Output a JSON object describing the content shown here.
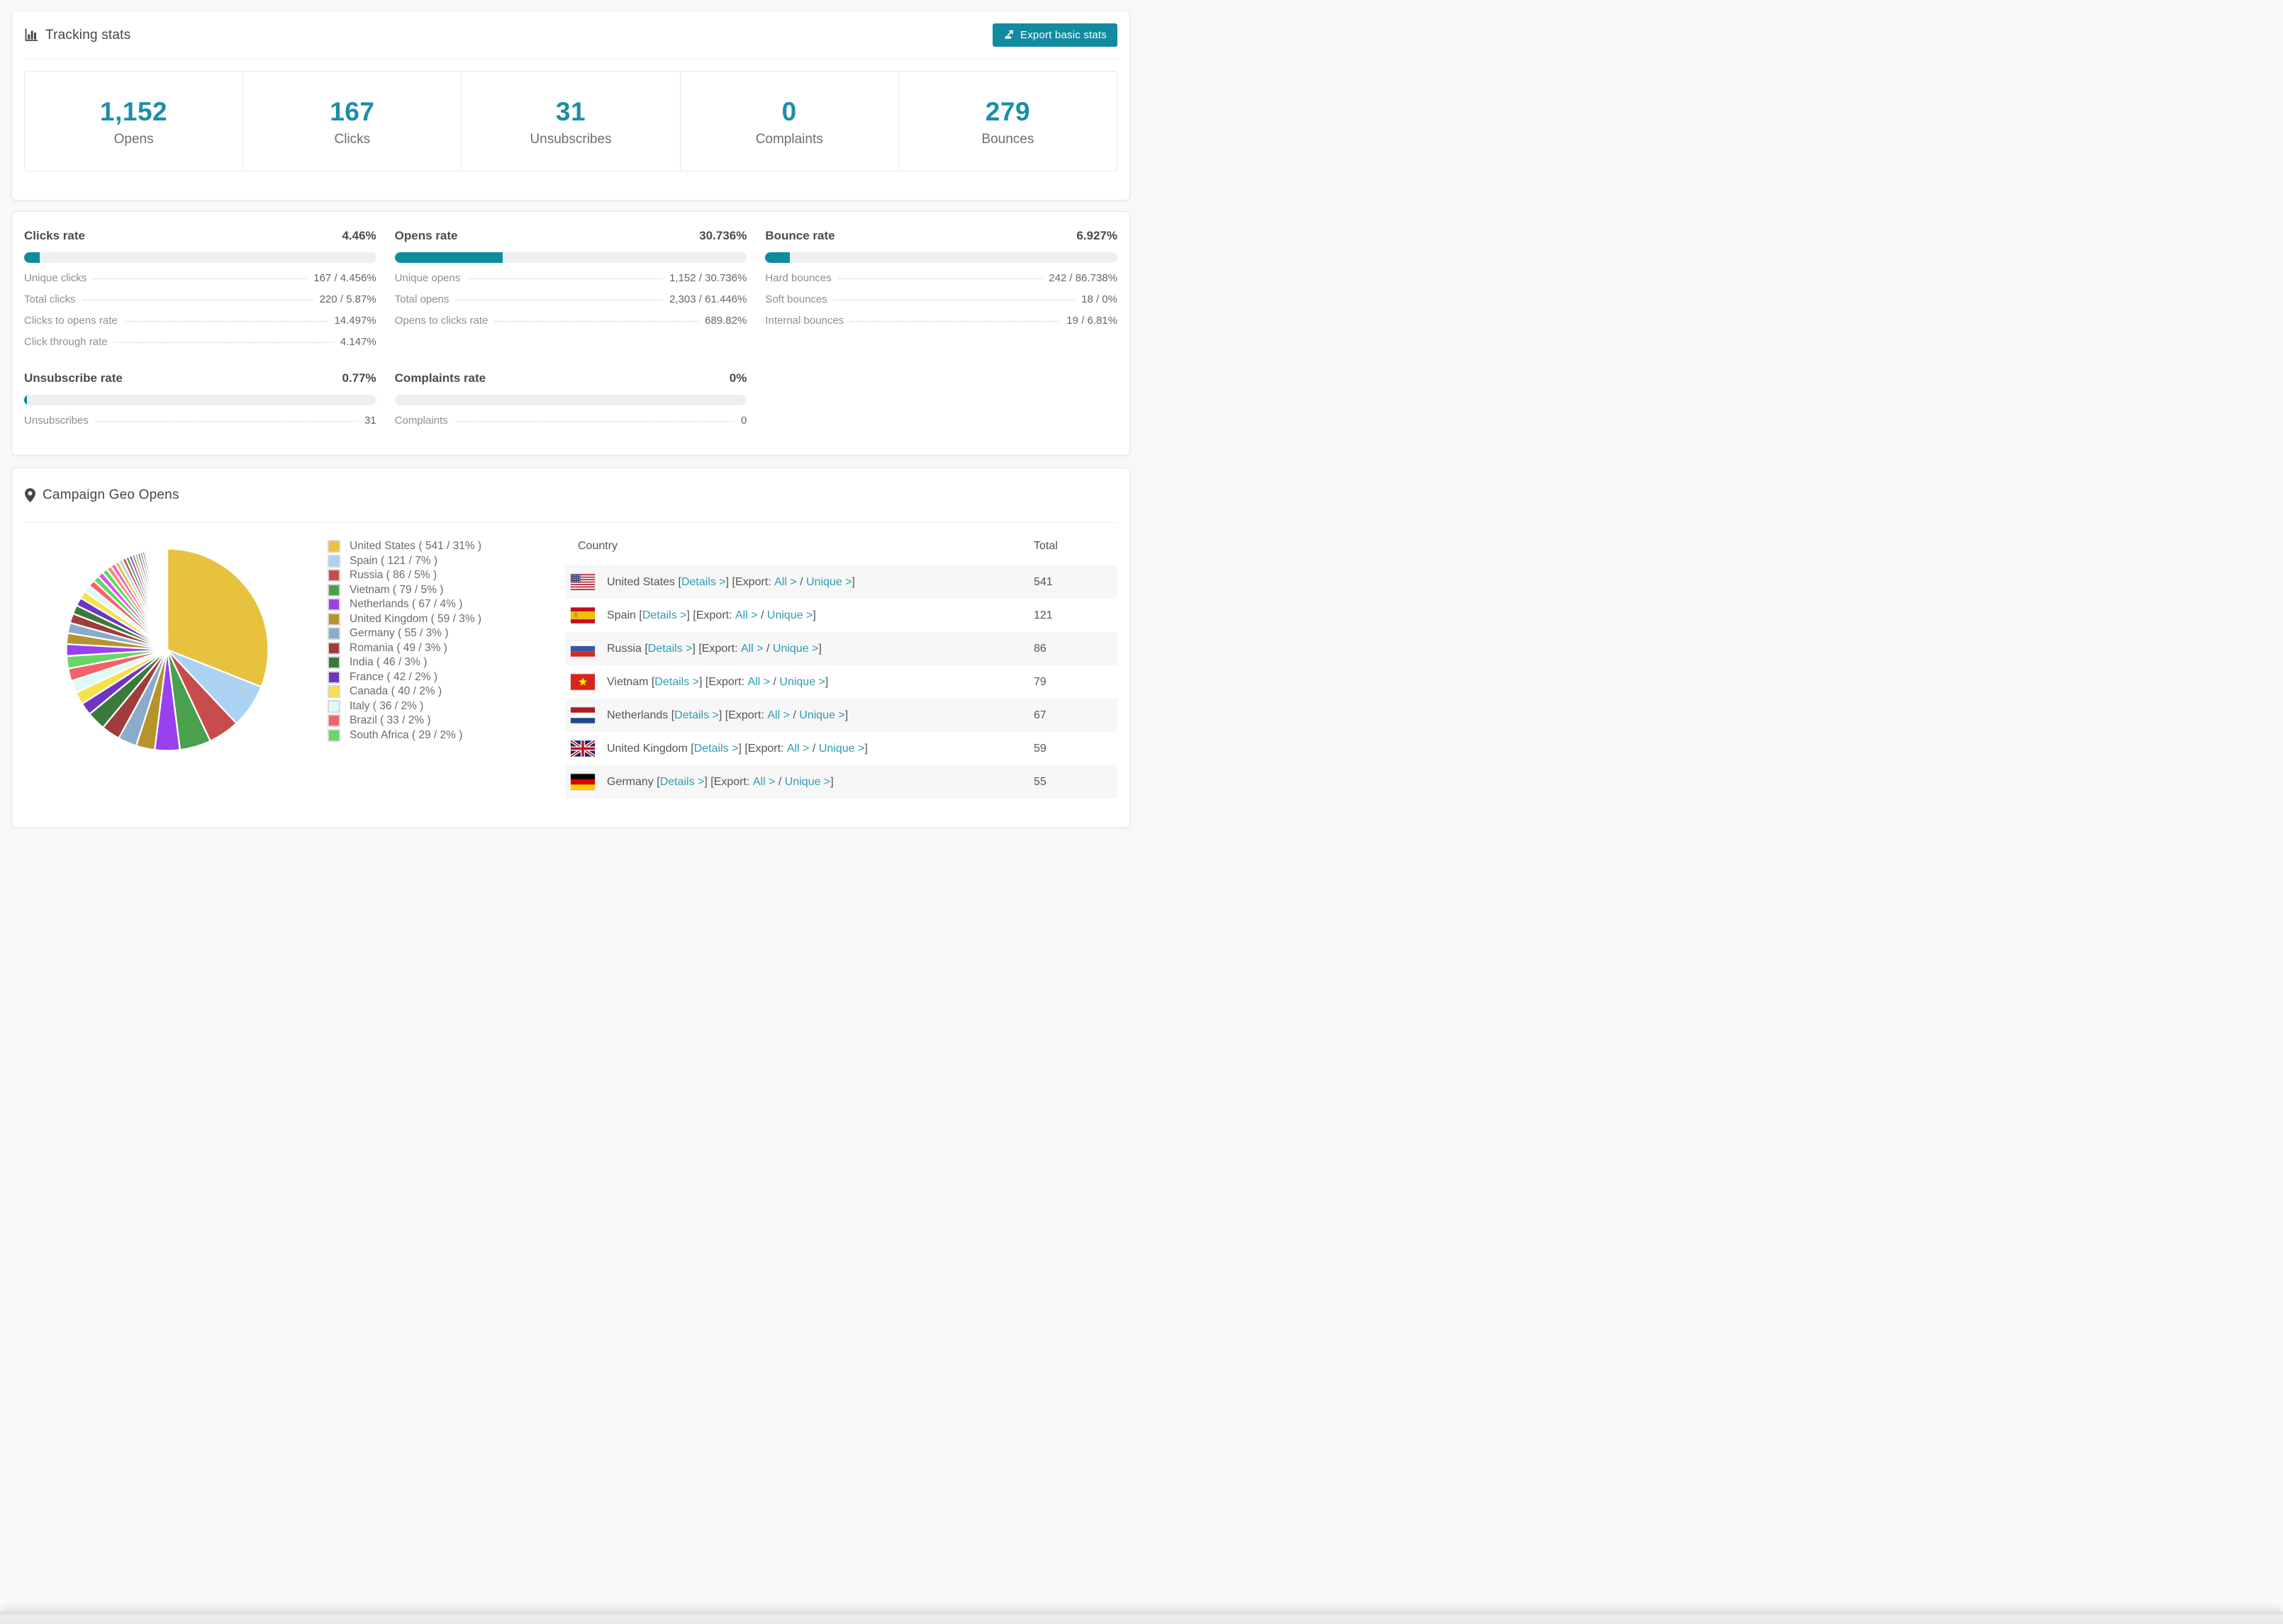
{
  "theme": {
    "accent": "#128ba1",
    "bar_fill": "#0c8ba1",
    "number_color": "#1b8ea8",
    "link_color": "#2d9cb3",
    "stripe": "#f7f7f8",
    "page_bg": "#f7f8f9"
  },
  "tracking": {
    "title": "Tracking stats",
    "export_button": "Export basic stats",
    "stats": [
      {
        "value": "1,152",
        "label": "Opens"
      },
      {
        "value": "167",
        "label": "Clicks"
      },
      {
        "value": "31",
        "label": "Unsubscribes"
      },
      {
        "value": "0",
        "label": "Complaints"
      },
      {
        "value": "279",
        "label": "Bounces"
      }
    ]
  },
  "rates": [
    {
      "title": "Clicks rate",
      "value": "4.46%",
      "pct": 4.46,
      "rows": [
        {
          "label": "Unique clicks",
          "value": "167 / 4.456%"
        },
        {
          "label": "Total clicks",
          "value": "220 / 5.87%"
        },
        {
          "label": "Clicks to opens rate",
          "value": "14.497%"
        },
        {
          "label": "Click through rate",
          "value": "4.147%"
        }
      ]
    },
    {
      "title": "Opens rate",
      "value": "30.736%",
      "pct": 30.736,
      "rows": [
        {
          "label": "Unique opens",
          "value": "1,152 / 30.736%"
        },
        {
          "label": "Total opens",
          "value": "2,303 / 61.446%"
        },
        {
          "label": "Opens to clicks rate",
          "value": "689.82%"
        }
      ]
    },
    {
      "title": "Bounce rate",
      "value": "6.927%",
      "pct": 6.927,
      "rows": [
        {
          "label": "Hard bounces",
          "value": "242 / 86.738%"
        },
        {
          "label": "Soft bounces",
          "value": "18 / 0%"
        },
        {
          "label": "Internal bounces",
          "value": "19 / 6.81%"
        }
      ]
    },
    {
      "title": "Unsubscribe rate",
      "value": "0.77%",
      "pct": 0.77,
      "rows": [
        {
          "label": "Unsubscribes",
          "value": "31"
        }
      ]
    },
    {
      "title": "Complaints rate",
      "value": "0%",
      "pct": 0,
      "rows": [
        {
          "label": "Complaints",
          "value": "0"
        }
      ]
    }
  ],
  "geo": {
    "title": "Campaign Geo Opens",
    "table": {
      "headers": [
        "Country",
        "Total"
      ],
      "link_details": "Details >",
      "export_prefix": "Export:",
      "link_all": "All >",
      "link_unique": "Unique >",
      "rows": [
        {
          "code": "us",
          "country": "United States",
          "total": "541"
        },
        {
          "code": "es",
          "country": "Spain",
          "total": "121"
        },
        {
          "code": "ru",
          "country": "Russia",
          "total": "86"
        },
        {
          "code": "vn",
          "country": "Vietnam",
          "total": "79"
        },
        {
          "code": "nl",
          "country": "Netherlands",
          "total": "67"
        },
        {
          "code": "gb",
          "country": "United Kingdom",
          "total": "59"
        },
        {
          "code": "de",
          "country": "Germany",
          "total": "55"
        }
      ]
    }
  },
  "chart_data": {
    "type": "pie",
    "title": "Campaign Geo Opens",
    "legend_position": "right-of-pie",
    "entries": [
      {
        "label": "United States",
        "value": 541,
        "pct": 31,
        "color": "#e8c23e"
      },
      {
        "label": "Spain",
        "value": 121,
        "pct": 7,
        "color": "#abd2f1"
      },
      {
        "label": "Russia",
        "value": 86,
        "pct": 5,
        "color": "#c94c4c"
      },
      {
        "label": "Vietnam",
        "value": 79,
        "pct": 5,
        "color": "#49a04d"
      },
      {
        "label": "Netherlands",
        "value": 67,
        "pct": 4,
        "color": "#9a41ee"
      },
      {
        "label": "United Kingdom",
        "value": 59,
        "pct": 3,
        "color": "#b5942c"
      },
      {
        "label": "Germany",
        "value": 55,
        "pct": 3,
        "color": "#8aabca"
      },
      {
        "label": "Romania",
        "value": 49,
        "pct": 3,
        "color": "#a03c3c"
      },
      {
        "label": "India",
        "value": 46,
        "pct": 3,
        "color": "#3b7a3c"
      },
      {
        "label": "France",
        "value": 42,
        "pct": 2,
        "color": "#6e35c1"
      },
      {
        "label": "Canada",
        "value": 40,
        "pct": 2,
        "color": "#f6e14b"
      },
      {
        "label": "Italy",
        "value": 36,
        "pct": 2,
        "color": "#dcfcf5"
      },
      {
        "label": "Brazil",
        "value": 33,
        "pct": 2,
        "color": "#f4626a"
      },
      {
        "label": "South Africa",
        "value": 29,
        "pct": 2,
        "color": "#66d667"
      }
    ],
    "others_total_pct": 26,
    "others_slice_count": 44,
    "others_decay": 0.93,
    "palette": [
      "#e8c23e",
      "#abd2f1",
      "#c94c4c",
      "#49a04d",
      "#9a41ee",
      "#b5942c",
      "#8aabca",
      "#a03c3c",
      "#3b7a3c",
      "#6e35c1",
      "#f6e14b",
      "#dcfcf5",
      "#f4626a",
      "#66d667",
      "#e353e8",
      "#58de5f",
      "#fd8a75",
      "#f263c9"
    ]
  }
}
